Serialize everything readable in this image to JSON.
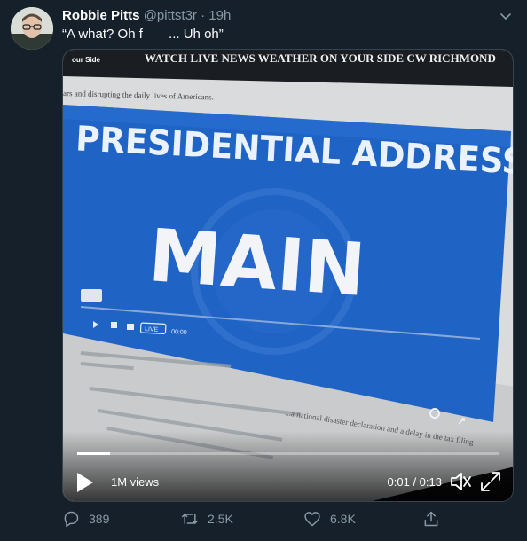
{
  "tweet": {
    "author_name": "Robbie Pitts",
    "handle": "@pittst3r",
    "separator": "·",
    "time": "19h",
    "text": "“A what? Oh f       ... Uh oh”"
  },
  "video": {
    "nav_text": "WATCH LIVE  NEWS  WEATHER  ON YOUR SIDE  CW RICHMOND",
    "nav_corner": "our Side",
    "subtext": "ars and disrupting the daily lives of Americans.",
    "headline": "PRESIDENTIAL ADDRESS",
    "main_word": "MAIN",
    "live_badge": "LIVE",
    "inner_time": "00:00",
    "article_text_1": "...a national disaster declaration and a delay in the tax filing",
    "views": "1M views",
    "timecode": "0:01 / 0:13",
    "progress_fraction": 0.077
  },
  "actions": {
    "replies": "389",
    "retweets": "2.5K",
    "likes": "6.8K"
  },
  "colors": {
    "background": "#15202b",
    "secondary_text": "#8899a6",
    "screen_blue": "#1f63c4"
  }
}
